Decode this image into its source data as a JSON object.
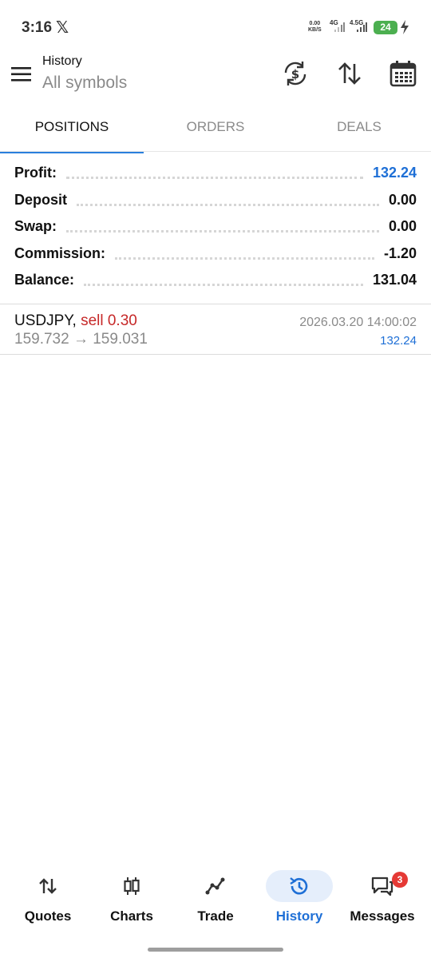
{
  "status_bar": {
    "time": "3:16",
    "x_logo": "𝕏",
    "net_speed_value": "0.00",
    "net_speed_unit": "KB/S",
    "net_type_1": "4G",
    "net_type_2": "4.5G",
    "battery": "24"
  },
  "header": {
    "subtitle": "History",
    "title": "All symbols",
    "icons": [
      "currency-refresh-icon",
      "sort-icon",
      "calendar-icon"
    ]
  },
  "tabs": [
    {
      "label": "POSITIONS",
      "active": true
    },
    {
      "label": "ORDERS",
      "active": false
    },
    {
      "label": "DEALS",
      "active": false
    }
  ],
  "summary": [
    {
      "label": "Profit:",
      "value": "132.24",
      "highlight": true
    },
    {
      "label": "Deposit",
      "value": "0.00",
      "highlight": false
    },
    {
      "label": "Swap:",
      "value": "0.00",
      "highlight": false
    },
    {
      "label": "Commission:",
      "value": "-1.20",
      "highlight": false
    },
    {
      "label": "Balance:",
      "value": "131.04",
      "highlight": false
    }
  ],
  "positions": [
    {
      "symbol": "USDJPY,",
      "side": "sell 0.30",
      "prices": "159.732 → 159.031",
      "time": "2026.03.20 14:00:02",
      "profit": "132.24"
    }
  ],
  "bottom_nav": [
    {
      "label": "Quotes",
      "icon": "quotes-icon",
      "active": false
    },
    {
      "label": "Charts",
      "icon": "candles-icon",
      "active": false
    },
    {
      "label": "Trade",
      "icon": "trade-icon",
      "active": false
    },
    {
      "label": "History",
      "icon": "history-icon",
      "active": true
    },
    {
      "label": "Messages",
      "icon": "messages-icon",
      "active": false,
      "badge": "3"
    }
  ],
  "colors": {
    "accent_blue": "#1e6fd6",
    "sell_red": "#c62828",
    "badge_red": "#e53935",
    "battery_green": "#4caf50"
  }
}
